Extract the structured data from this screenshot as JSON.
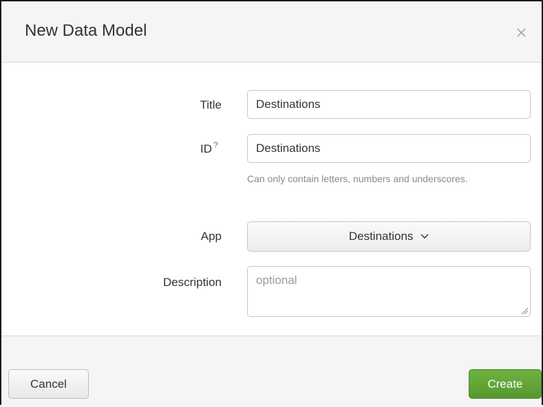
{
  "dialog": {
    "title": "New Data Model",
    "close_icon": "close-icon"
  },
  "form": {
    "title": {
      "label": "Title",
      "value": "Destinations"
    },
    "id": {
      "label": "ID",
      "help_mark": "?",
      "value": "Destinations",
      "help_text": "Can only contain letters, numbers and underscores."
    },
    "app": {
      "label": "App",
      "selected": "Destinations",
      "icon": "chevron-down-icon"
    },
    "description": {
      "label": "Description",
      "placeholder": "optional",
      "value": ""
    }
  },
  "footer": {
    "cancel_label": "Cancel",
    "create_label": "Create"
  },
  "colors": {
    "primary_button": "#5ba534",
    "help_link": "#5379af"
  }
}
